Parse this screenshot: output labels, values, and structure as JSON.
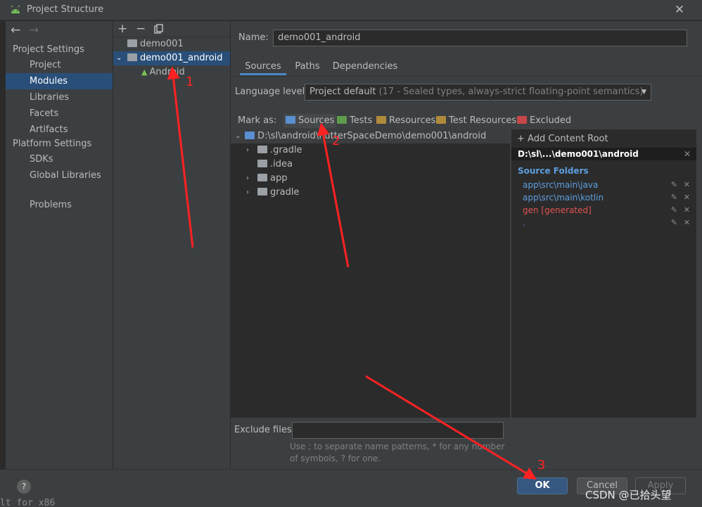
{
  "window": {
    "title": "Project Structure",
    "close_icon": "close-icon"
  },
  "left_nav": {
    "project_settings_header": "Project Settings",
    "project_settings_items": [
      "Project",
      "Modules",
      "Libraries",
      "Facets",
      "Artifacts"
    ],
    "platform_settings_header": "Platform Settings",
    "platform_settings_items": [
      "SDKs",
      "Global Libraries"
    ],
    "other_items": [
      "Problems"
    ],
    "selected": "Modules"
  },
  "modules_tree": {
    "toolbar": {
      "add": "+",
      "remove": "−",
      "copy": "copy-icon"
    },
    "items": [
      {
        "label": "demo001",
        "selected": false
      },
      {
        "label": "demo001_android",
        "selected": true
      },
      {
        "label": "Android",
        "selected": false
      }
    ]
  },
  "module": {
    "name_label": "Name:",
    "name_value": "demo001_android",
    "tabs": [
      "Sources",
      "Paths",
      "Dependencies"
    ],
    "active_tab": "Sources",
    "language_level_label": "Language level:",
    "language_level_value": "Project default",
    "language_level_hint": "(17 - Sealed types, always-strict floating-point semantics)",
    "mark_as_label": "Mark as:",
    "mark_as_buttons": [
      "Sources",
      "Tests",
      "Resources",
      "Test Resources",
      "Excluded"
    ],
    "content_tree": {
      "root": "D:\\sl\\android\\flutterSpaceDemo\\demo001\\android",
      "children": [
        ".gradle",
        ".idea",
        "app",
        "gradle"
      ]
    },
    "exclude_files_label": "Exclude files:",
    "exclude_files_value": "",
    "exclude_hint_line1": "Use ; to separate name patterns, * for any number",
    "exclude_hint_line2": "of symbols, ? for one."
  },
  "content_root_panel": {
    "add_label": "+ Add Content Root",
    "root_path": "D:\\sl\\...\\demo001\\android",
    "source_folders_header": "Source Folders",
    "source_folders": [
      {
        "path": "app\\src\\main\\java",
        "color": "#5d9fe0"
      },
      {
        "path": "app\\src\\main\\kotlin",
        "color": "#5d9fe0"
      },
      {
        "path": "gen [generated]",
        "color": "#e05252"
      },
      {
        "path": ".",
        "color": "#5d9fe0"
      }
    ]
  },
  "footer": {
    "help": "?",
    "ok": "OK",
    "cancel": "Cancel",
    "apply": "Apply"
  },
  "annotations": {
    "one": "1",
    "two": "2",
    "three": "3"
  },
  "watermark": "CSDN @已拾头望",
  "background_text": "lt for x86",
  "colors": {
    "selection": "#294f79",
    "ok_button": "#365880",
    "annotation": "#ff2222"
  }
}
